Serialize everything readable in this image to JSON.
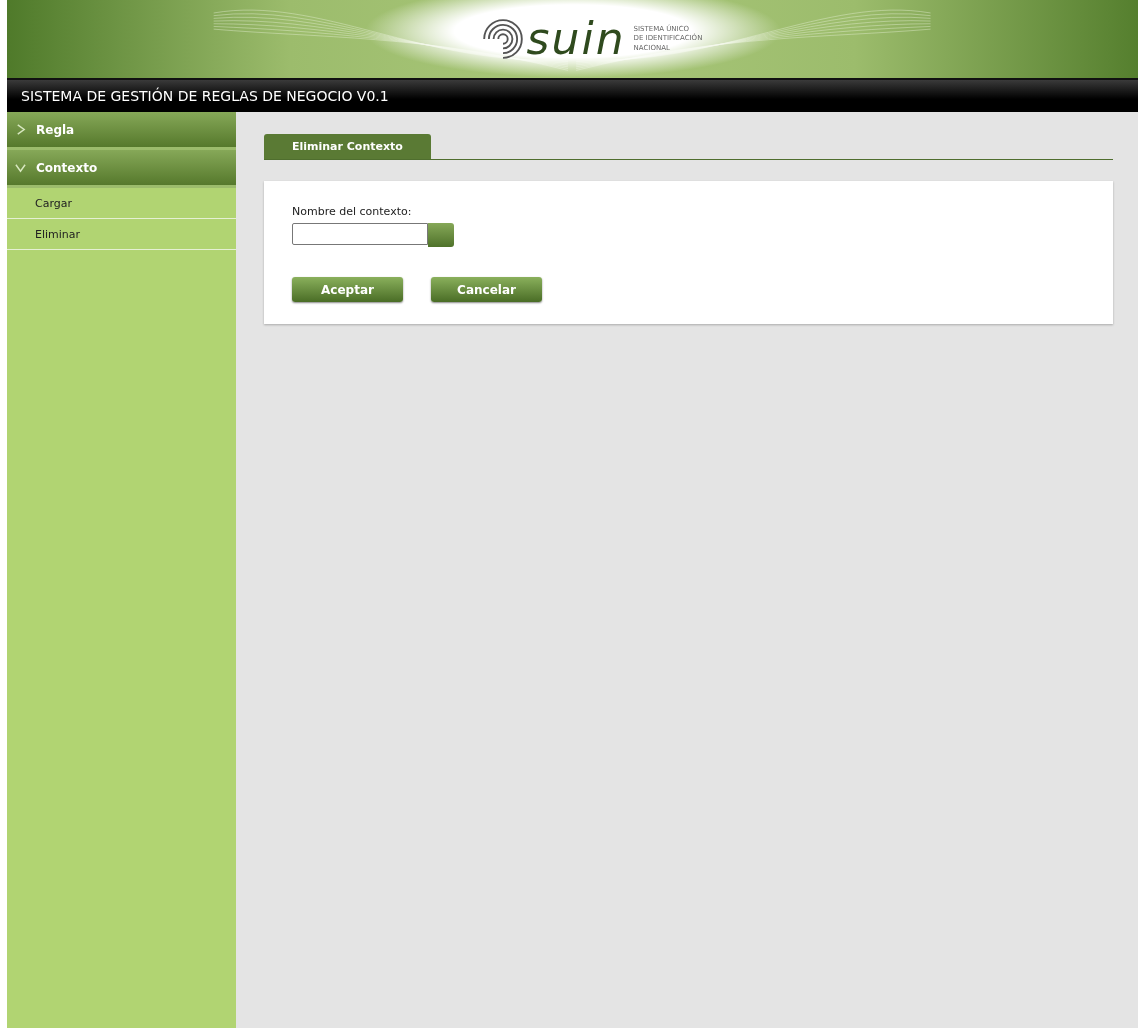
{
  "header": {
    "logo_text": "suin",
    "logo_subtitle": [
      "SISTEMA ÚNICO",
      "DE IDENTIFICACIÓN",
      "NACIONAL"
    ]
  },
  "title_bar": "SISTEMA DE GESTIÓN DE REGLAS DE NEGOCIO V0.1",
  "sidebar": {
    "sections": [
      {
        "label": "Regla",
        "expanded": false
      },
      {
        "label": "Contexto",
        "expanded": true,
        "children": [
          {
            "label": "Cargar"
          },
          {
            "label": "Eliminar"
          }
        ]
      }
    ]
  },
  "tabs": [
    {
      "label": "Eliminar Contexto",
      "selected": true
    }
  ],
  "form": {
    "field_label": "Nombre del contexto:",
    "buttons": [
      "Aceptar",
      "Cancelar"
    ]
  }
}
